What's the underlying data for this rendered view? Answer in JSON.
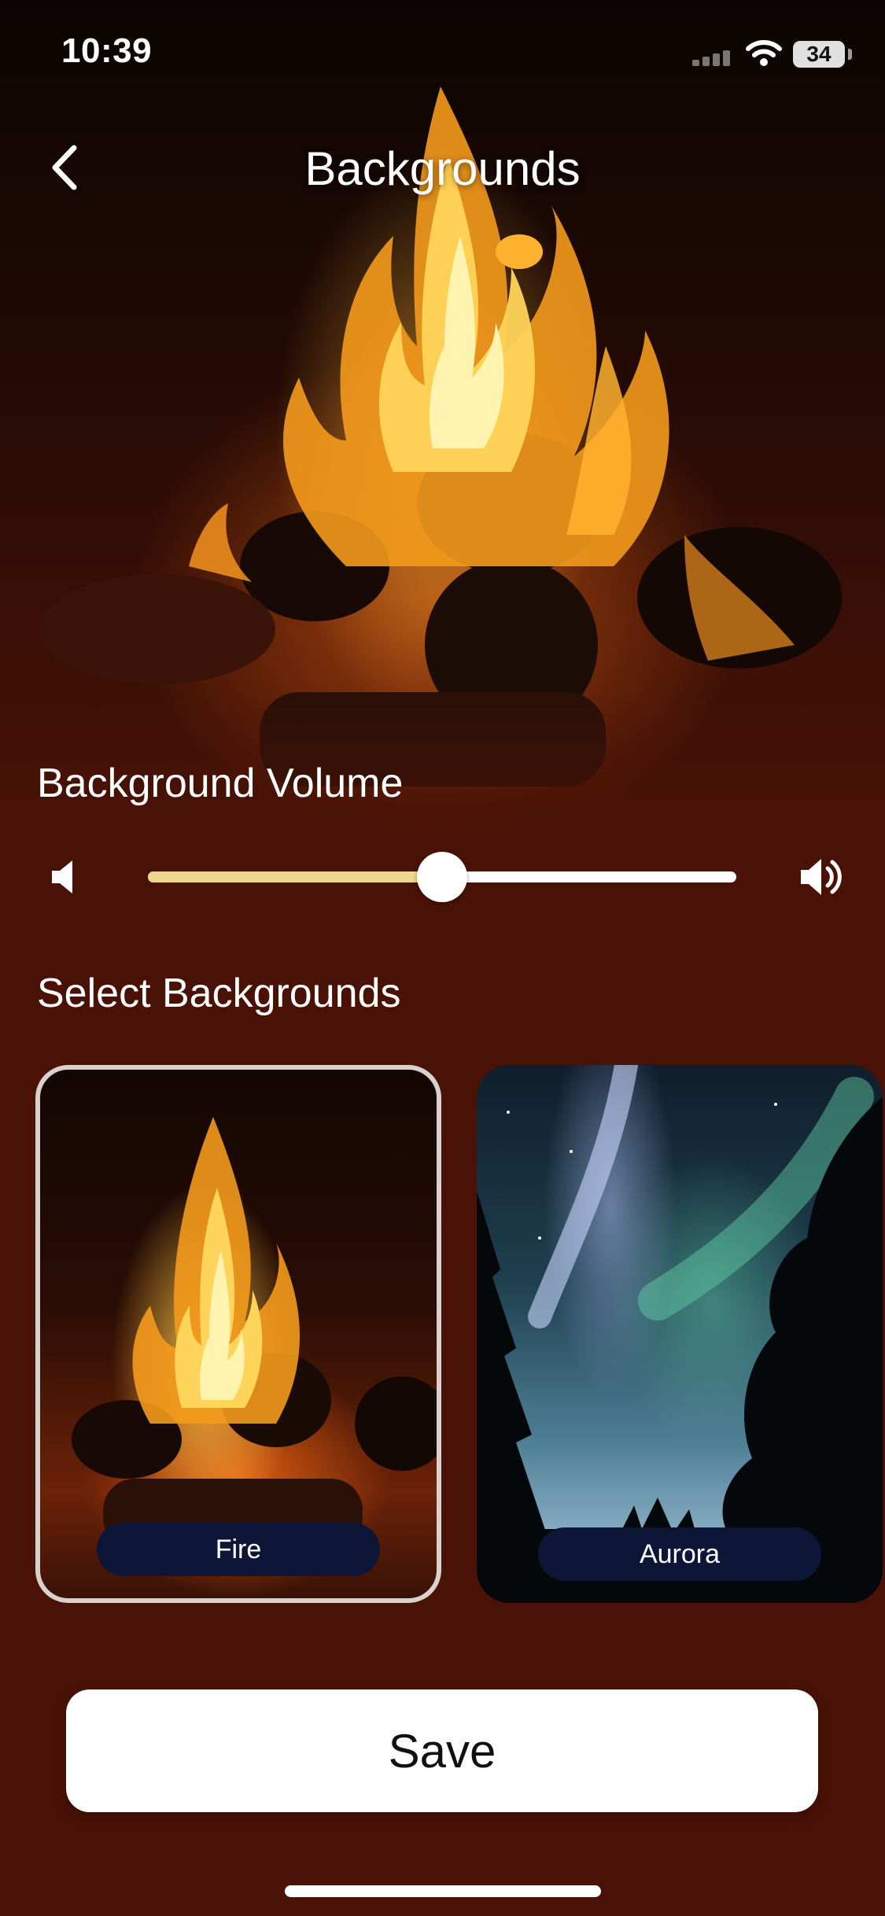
{
  "status_bar": {
    "time": "10:39",
    "battery": "34"
  },
  "header": {
    "title": "Backgrounds",
    "back_icon": "chevron-left-icon"
  },
  "volume": {
    "label": "Background Volume",
    "level": 0.5,
    "low_icon": "speaker-low-icon",
    "high_icon": "speaker-high-icon",
    "fill_color": "#f0d68a"
  },
  "backgrounds": {
    "label": "Select Backgrounds",
    "items": [
      {
        "name": "Fire",
        "selected": true
      },
      {
        "name": "Aurora",
        "selected": false
      }
    ]
  },
  "actions": {
    "save_label": "Save"
  },
  "colors": {
    "background": "#4a1206",
    "label_pill": "#0e1638",
    "button": "#ffffff"
  }
}
